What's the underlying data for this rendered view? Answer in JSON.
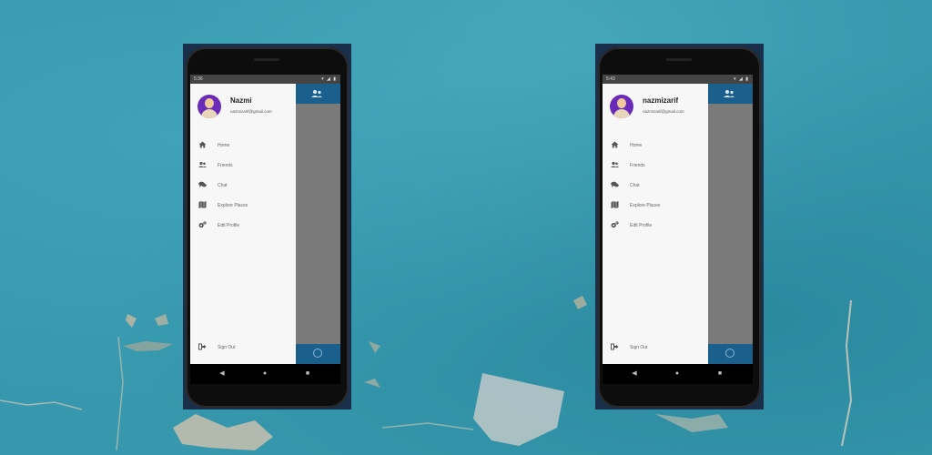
{
  "phones": [
    {
      "status_time": "5:36",
      "status_icons": "▾ ◢ ▮",
      "profile_name": "Nazmi",
      "profile_email": "nazmizarif@gmail.com",
      "menu": [
        {
          "label": "Home",
          "icon": "home-icon",
          "glyph": "⌂"
        },
        {
          "label": "Friends",
          "icon": "friends-icon",
          "glyph": "👥"
        },
        {
          "label": "Chat",
          "icon": "chat-icon",
          "glyph": "💬"
        },
        {
          "label": "Explore Places",
          "icon": "map-icon",
          "glyph": "▤"
        },
        {
          "label": "Edit Profile",
          "icon": "settings-icon",
          "glyph": "⚙"
        }
      ],
      "sign_out": {
        "label": "Sign Out",
        "icon": "sign-out-icon",
        "glyph": "⇥"
      }
    },
    {
      "status_time": "5:43",
      "status_icons": "▾ ◢ ▮",
      "profile_name": "nazmizarif",
      "profile_email": "nazmizarif@gmail.com",
      "menu": [
        {
          "label": "Home",
          "icon": "home-icon",
          "glyph": "⌂"
        },
        {
          "label": "Friends",
          "icon": "friends-icon",
          "glyph": "👥"
        },
        {
          "label": "Chat",
          "icon": "chat-icon",
          "glyph": "💬"
        },
        {
          "label": "Explore Places",
          "icon": "map-icon",
          "glyph": "▤"
        },
        {
          "label": "Edit Profile",
          "icon": "settings-icon",
          "glyph": "⚙"
        }
      ],
      "sign_out": {
        "label": "Sign Out",
        "icon": "sign-out-icon",
        "glyph": "⇥"
      }
    }
  ],
  "appbar_icon": "add-friend-icon",
  "fab_icon": "compass-icon",
  "navbar": {
    "back": "◀",
    "home": "●",
    "recent": "■"
  },
  "colors": {
    "background": "#3798ad",
    "appbar": "#1b5f8c",
    "drawer": "#f7f7f7",
    "avatar": "#6a2bb8"
  }
}
